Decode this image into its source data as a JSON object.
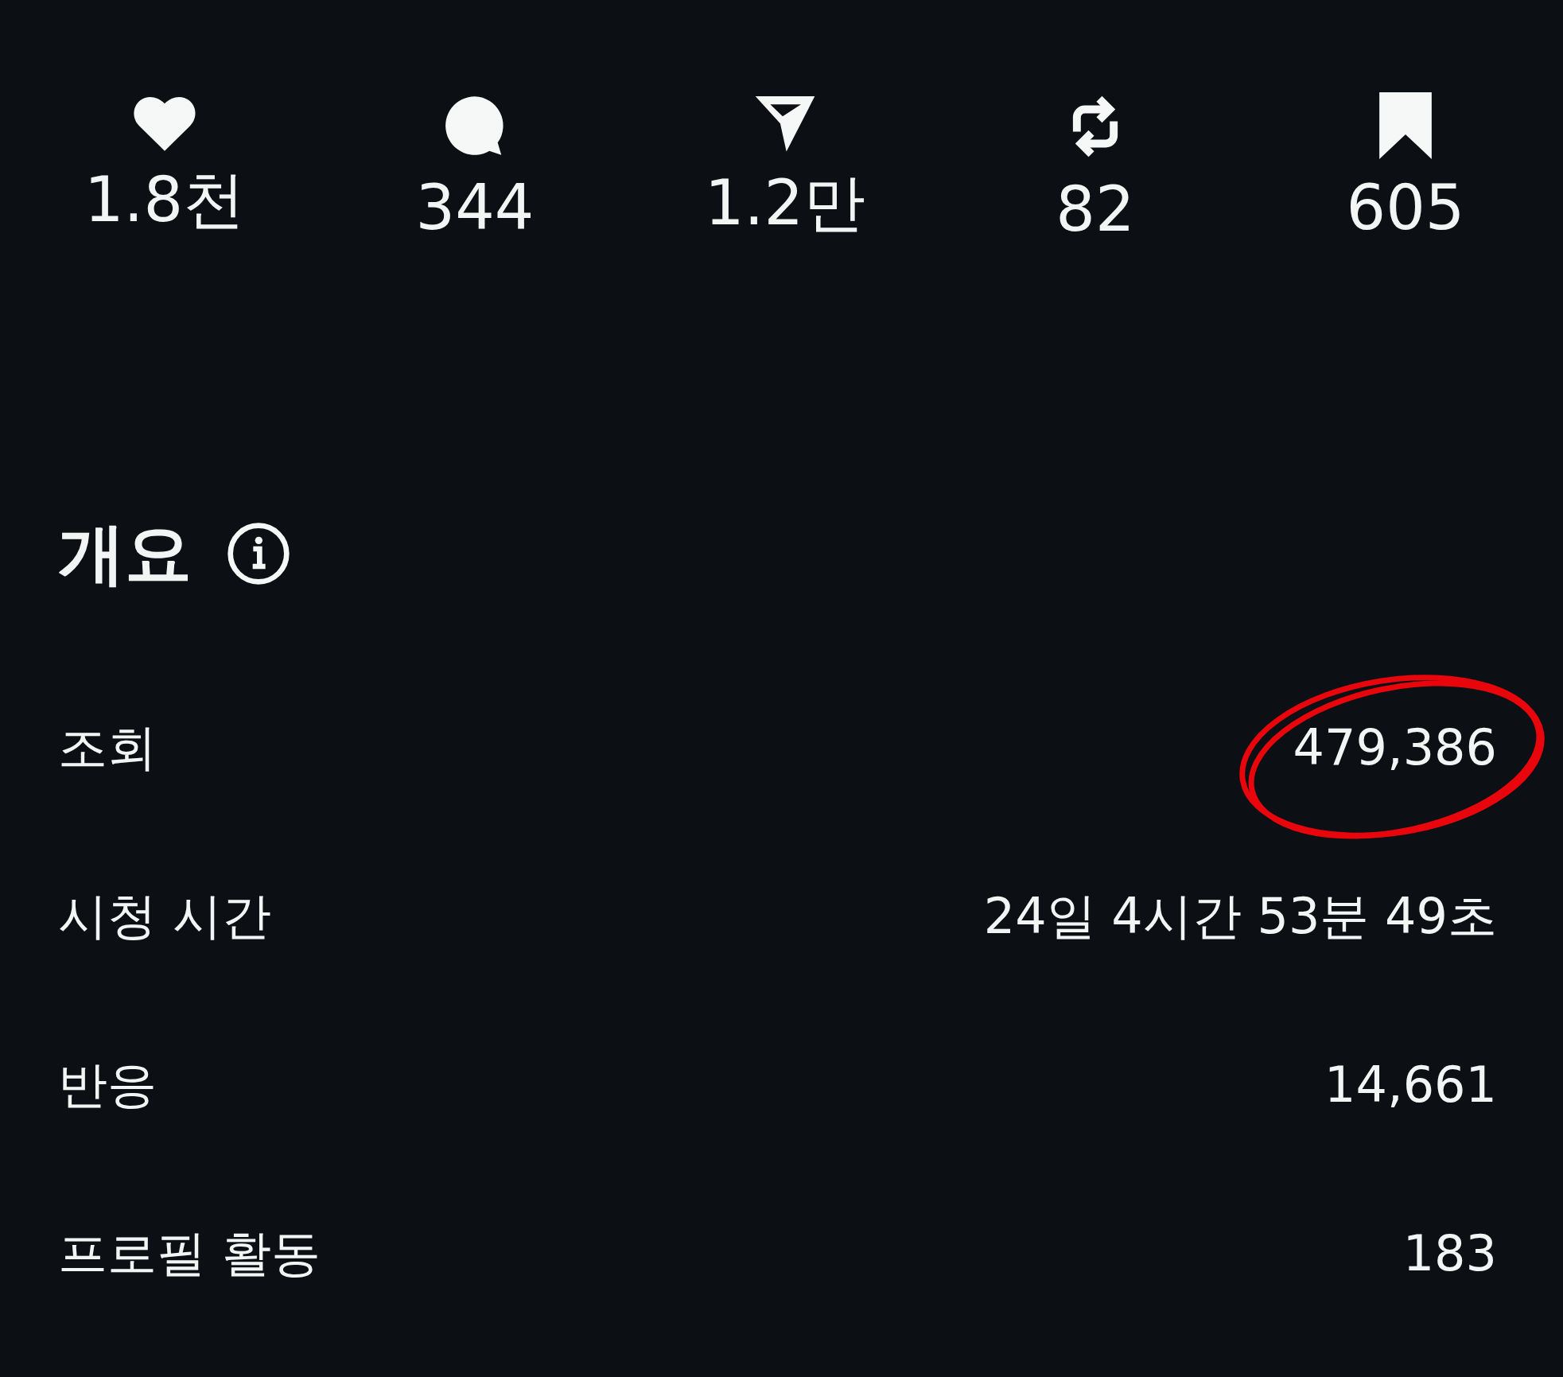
{
  "stats": [
    {
      "kind": "like",
      "count": "1.8천"
    },
    {
      "kind": "comment",
      "count": "344"
    },
    {
      "kind": "share",
      "count": "1.2만"
    },
    {
      "kind": "repost",
      "count": "82"
    },
    {
      "kind": "save",
      "count": "605"
    }
  ],
  "overview": {
    "title": "개요",
    "rows": [
      {
        "label": "조회",
        "value": "479,386",
        "highlighted": true
      },
      {
        "label": "시청 시간",
        "value": "24일 4시간 53분 49초",
        "highlighted": false
      },
      {
        "label": "반응",
        "value": "14,661",
        "highlighted": false
      },
      {
        "label": "프로필 활동",
        "value": "183",
        "highlighted": false
      }
    ]
  }
}
